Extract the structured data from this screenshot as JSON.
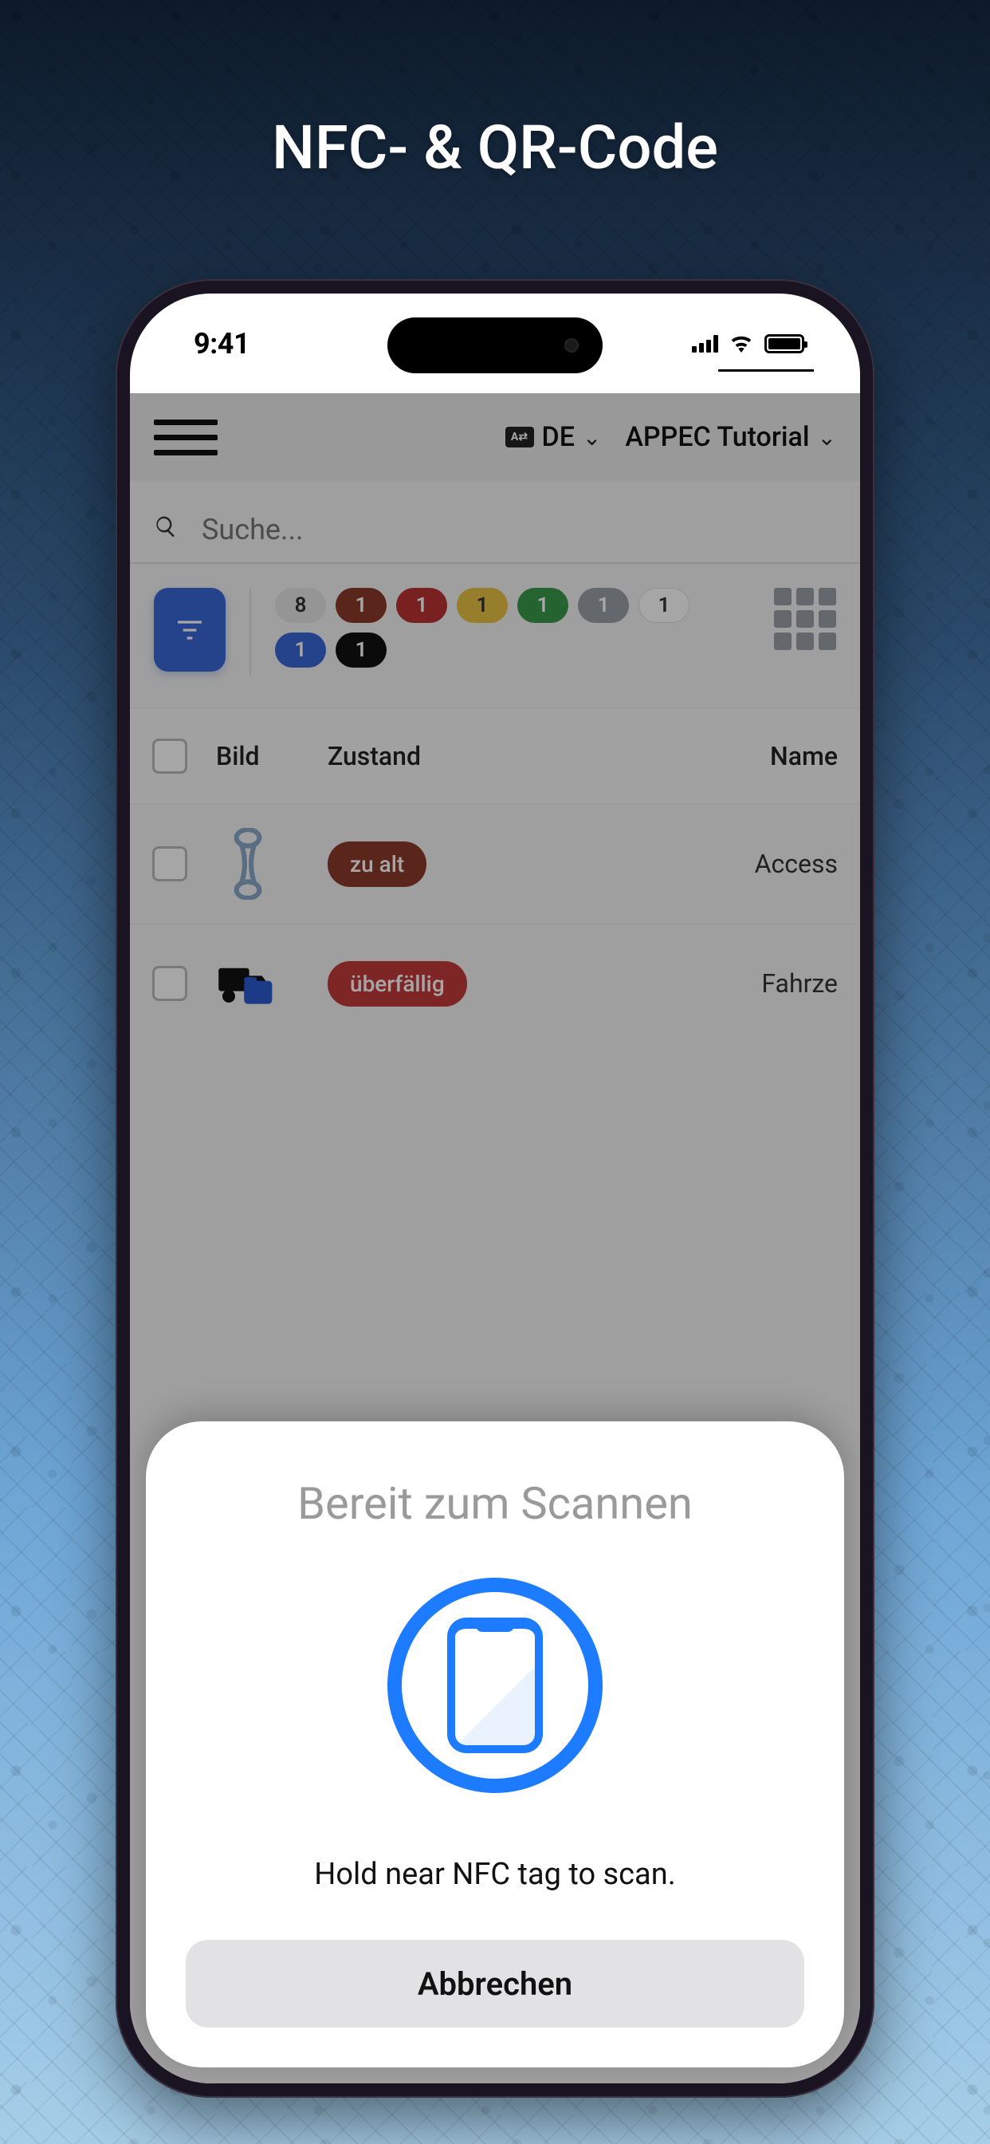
{
  "promo": {
    "title": "NFC- & QR-Code"
  },
  "status": {
    "time": "9:41"
  },
  "header": {
    "lang_label": "DE",
    "account_label": "APPEC Tutorial"
  },
  "search": {
    "placeholder": "Suche..."
  },
  "pills": [
    {
      "count": "8",
      "color": "gray-light"
    },
    {
      "count": "1",
      "color": "brown"
    },
    {
      "count": "1",
      "color": "red"
    },
    {
      "count": "1",
      "color": "yellow"
    },
    {
      "count": "1",
      "color": "green"
    },
    {
      "count": "1",
      "color": "gray"
    },
    {
      "count": "1",
      "color": "white"
    },
    {
      "count": "1",
      "color": "blue"
    },
    {
      "count": "1",
      "color": "black"
    }
  ],
  "table": {
    "headers": {
      "bild": "Bild",
      "zustand": "Zustand",
      "name": "Name"
    },
    "rows": [
      {
        "status_label": "zu alt",
        "status_color": "brown",
        "name": "Access",
        "thumb": "rope"
      },
      {
        "status_label": "überfällig",
        "status_color": "red",
        "name": "Fahrze",
        "thumb": "truck"
      }
    ]
  },
  "nfc": {
    "title": "Bereit zum Scannen",
    "instruction": "Hold near NFC tag to scan.",
    "cancel_label": "Abbrechen"
  }
}
